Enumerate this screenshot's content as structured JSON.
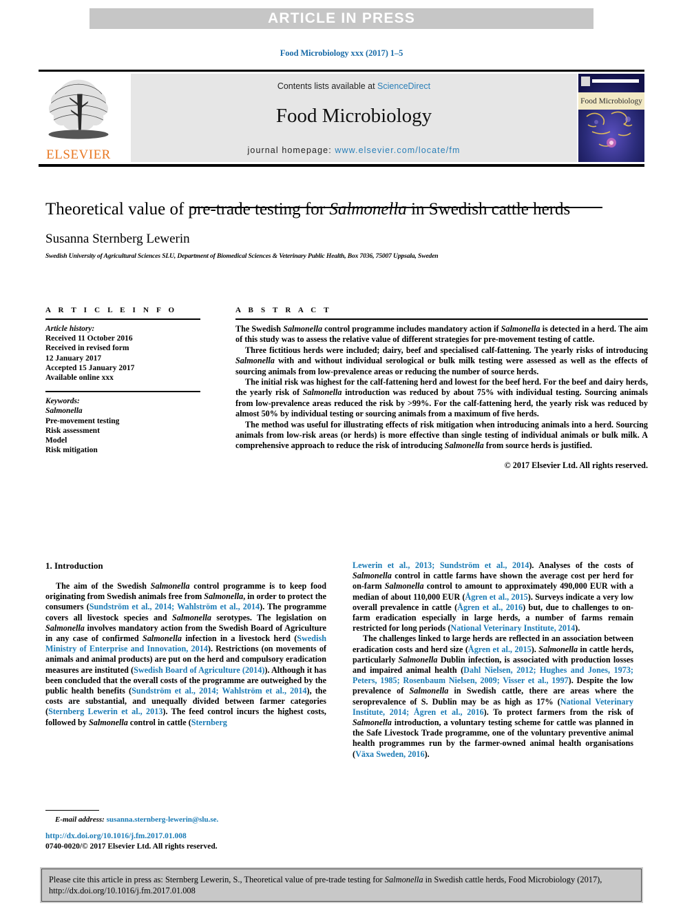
{
  "banner": {
    "text": "ARTICLE IN PRESS",
    "bg_color": "#c6c6c6",
    "text_color": "#ffffff"
  },
  "journal_ref": "Food Microbiology xxx (2017) 1–5",
  "masthead": {
    "publisher": "ELSEVIER",
    "publisher_color": "#e87722",
    "contents_label": "Contents lists available at ",
    "contents_link": "ScienceDirect",
    "journal_title": "Food Microbiology",
    "homepage_label": "journal homepage: ",
    "homepage_url": "www.elsevier.com/locate/fm",
    "cover_title": "Food Microbiology",
    "link_color": "#2a7fb8"
  },
  "title": {
    "line1_a": "Theoretical value of pre-trade testing for ",
    "line1_italic": "Salmonella",
    "line1_b": " in Swedish cattle herds",
    "author": "Susanna Sternberg Lewerin",
    "affiliation": "Swedish University of Agricultural Sciences SLU, Department of Biomedical Sciences & Veterinary Public Health, Box 7036, 75007 Uppsala, Sweden"
  },
  "article_info": {
    "heading": "A R T I C L E  I N F O",
    "history_label": "Article history:",
    "history": [
      "Received 11 October 2016",
      "Received in revised form",
      "12 January 2017",
      "Accepted 15 January 2017",
      "Available online xxx"
    ],
    "keywords_label": "Keywords:",
    "keywords": [
      "Salmonella",
      "Pre-movement testing",
      "Risk assessment",
      "Model",
      "Risk mitigation"
    ]
  },
  "abstract": {
    "heading": "A B S T R A C T",
    "paragraphs": [
      "The Swedish <i>Salmonella</i> control programme includes mandatory action if <i>Salmonella</i> is detected in a herd. The aim of this study was to assess the relative value of different strategies for pre-movement testing of cattle.",
      "Three fictitious herds were included; dairy, beef and specialised calf-fattening. The yearly risks of introducing <i>Salmonella</i> with and without individual serological or bulk milk testing were assessed as well as the effects of sourcing animals from low-prevalence areas or reducing the number of source herds.",
      "The initial risk was highest for the calf-fattening herd and lowest for the beef herd. For the beef and dairy herds, the yearly risk of <i>Salmonella</i> introduction was reduced by about 75% with individual testing. Sourcing animals from low-prevalence areas reduced the risk by &gt;99%. For the calf-fattening herd, the yearly risk was reduced by almost 50% by individual testing or sourcing animals from a maximum of five herds.",
      "The method was useful for illustrating effects of risk mitigation when introducing animals into a herd. Sourcing animals from low-risk areas (or herds) is more effective than single testing of individual animals or bulk milk. A comprehensive approach to reduce the risk of introducing <i>Salmonella</i> from source herds is justified."
    ],
    "copyright": "© 2017 Elsevier Ltd. All rights reserved."
  },
  "introduction": {
    "heading": "1.  Introduction",
    "left_paragraphs": [
      "The aim of the Swedish <i>Salmonella</i> control programme is to keep food originating from Swedish animals free from <i>Salmonella</i>, in order to protect the consumers (<span class=\"ref\">Sundström et al., 2014; Wahlström et al., 2014</span>). The programme covers all livestock species and <i>Salmonella</i> serotypes. The legislation on <i>Salmonella</i> involves mandatory action from the Swedish Board of Agriculture in any case of confirmed <i>Salmonella</i> infection in a livestock herd (<span class=\"ref\">Swedish Ministry of Enterprise and Innovation, 2014</span>). Restrictions (on movements of animals and animal products) are put on the herd and compulsory eradication measures are instituted (<span class=\"ref\">Swedish Board of Agriculture (2014)</span>). Although it has been concluded that the overall costs of the programme are outweighed by the public health benefits (<span class=\"ref\">Sundström et al., 2014; Wahlström et al., 2014</span>), the costs are substantial, and unequally divided between farmer categories (<span class=\"ref\">Sternberg Lewerin et al., 2013</span>). The feed control incurs the highest costs, followed by <i>Salmonella</i> control in cattle (<span class=\"ref\">Sternberg</span>"
    ],
    "right_paragraphs": [
      "<span class=\"ref\">Lewerin et al., 2013; Sundström et al., 2014</span>). Analyses of the costs of <i>Salmonella</i> control in cattle farms have shown the average cost per herd for on-farm <i>Salmonella</i> control to amount to approximately 490,000 EUR with a median of about 110,000 EUR (<span class=\"ref\">Ågren et al., 2015</span>). Surveys indicate a very low overall prevalence in cattle (<span class=\"ref\">Ågren et al., 2016</span>) but, due to challenges to on-farm eradication especially in large herds, a number of farms remain restricted for long periods (<span class=\"ref\">National Veterinary Institute, 2014</span>).",
      "The challenges linked to large herds are reflected in an association between eradication costs and herd size (<span class=\"ref\">Ågren et al., 2015</span>). <i>Salmonella</i> in cattle herds, particularly <i>Salmonella</i> Dublin infection, is associated with production losses and impaired animal health (<span class=\"ref\">Dahl Nielsen, 2012; Hughes and Jones, 1973; Peters, 1985; Rosenbaum Nielsen, 2009; Visser et al., 1997</span>). Despite the low prevalence of <i>Salmonella</i> in Swedish cattle, there are areas where the seroprevalence of S. Dublin may be as high as 17% (<span class=\"ref\">National Veterinary Institute, 2014; Ågren et al., 2016</span>). To protect farmers from the risk of <i>Salmonella</i> introduction, a voluntary testing scheme for cattle was planned in the Safe Livestock Trade programme, one of the voluntary preventive animal health programmes run by the farmer-owned animal health organisations (<span class=\"ref\">Växa Sweden, 2016</span>)."
    ]
  },
  "footer": {
    "email_label": "E-mail address:",
    "email": "susanna.sternberg-lewerin@slu.se.",
    "doi": "http://dx.doi.org/10.1016/j.fm.2017.01.008",
    "issn": "0740-0020/© 2017 Elsevier Ltd. All rights reserved.",
    "link_color": "#1b7bb5"
  },
  "citation_box": {
    "text_a": "Please cite this article in press as: Sternberg Lewerin, S., Theoretical value of pre-trade testing for ",
    "text_italic": "Salmonella",
    "text_b": " in Swedish cattle herds, Food Microbiology (2017), http://dx.doi.org/10.1016/j.fm.2017.01.008",
    "bg_color": "#c8c8c8"
  }
}
